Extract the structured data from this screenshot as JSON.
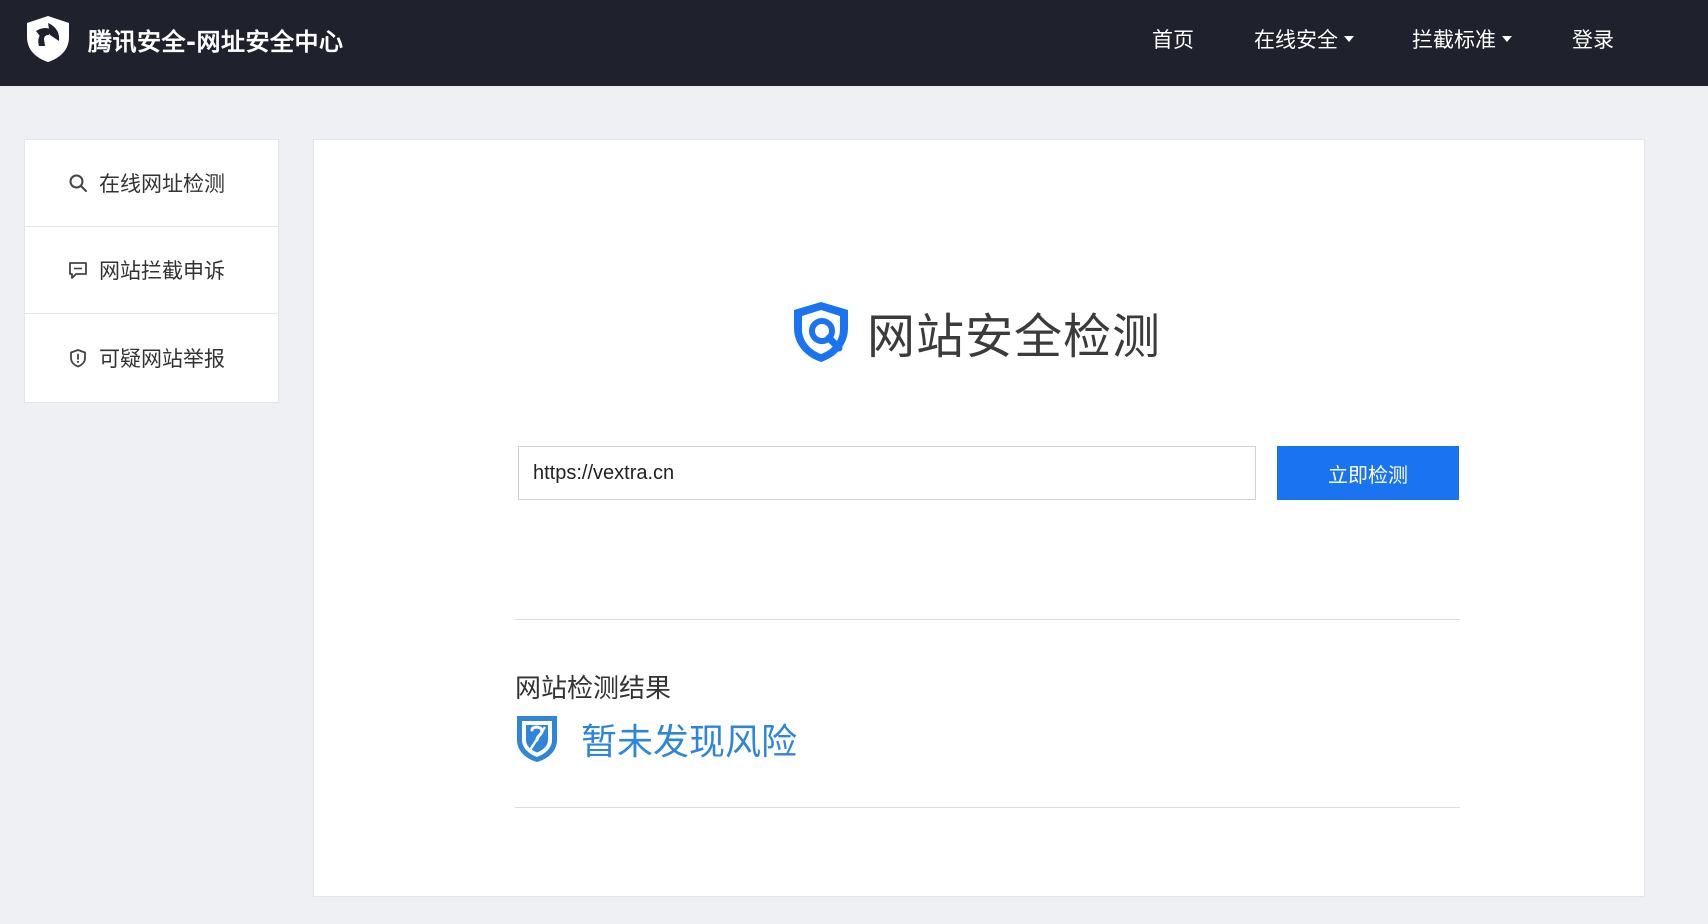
{
  "header": {
    "brand_title": "腾讯安全-网址安全中心",
    "nav": {
      "home": "首页",
      "online_security": "在线安全",
      "intercept_standard": "拦截标准",
      "login": "登录"
    },
    "colors": {
      "background": "#1f212c",
      "text": "#ffffff"
    }
  },
  "sidebar": {
    "items": [
      {
        "label": "在线网址检测",
        "icon": "search-icon"
      },
      {
        "label": "网站拦截申诉",
        "icon": "message-icon"
      },
      {
        "label": "可疑网站举报",
        "icon": "shield-alert-icon"
      }
    ]
  },
  "main": {
    "hero_title": "网站安全检测",
    "search": {
      "value": "https://vextra.cn",
      "button_label": "立即检测"
    },
    "result": {
      "heading": "网站检测结果",
      "status": "暂未发现风险",
      "status_icon": "shield-unknown-icon"
    },
    "colors": {
      "accent": "#1a73f0",
      "status": "#2f86d9"
    }
  }
}
